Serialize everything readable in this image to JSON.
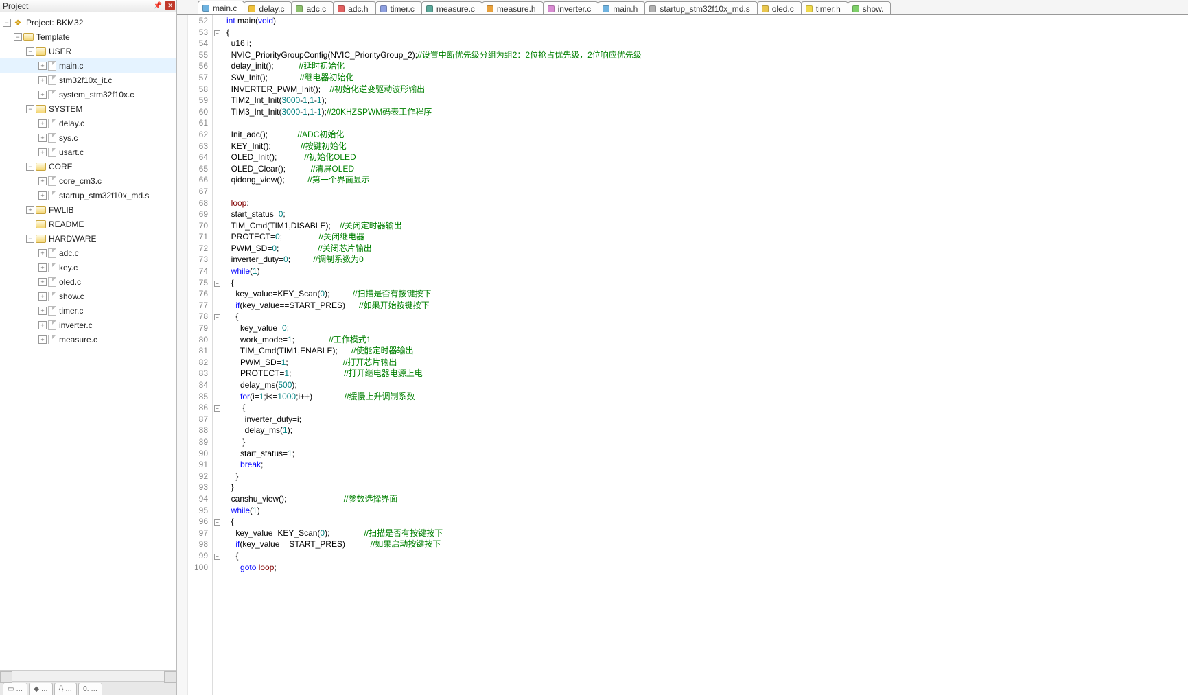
{
  "panel": {
    "title": "Project"
  },
  "tree": {
    "root": "Project: BKM32",
    "template": "Template",
    "groups": {
      "user": {
        "name": "USER",
        "files": [
          "main.c",
          "stm32f10x_it.c",
          "system_stm32f10x.c"
        ]
      },
      "system": {
        "name": "SYSTEM",
        "files": [
          "delay.c",
          "sys.c",
          "usart.c"
        ]
      },
      "core": {
        "name": "CORE",
        "files": [
          "core_cm3.c",
          "startup_stm32f10x_md.s"
        ]
      },
      "fwlib": {
        "name": "FWLIB"
      },
      "readme": {
        "name": "README"
      },
      "hardware": {
        "name": "HARDWARE",
        "files": [
          "adc.c",
          "key.c",
          "oled.c",
          "show.c",
          "timer.c",
          "inverter.c",
          "measure.c"
        ]
      }
    }
  },
  "tabs": [
    {
      "label": "main.c",
      "color": "#6fb3e0",
      "active": true
    },
    {
      "label": "delay.c",
      "color": "#f0c23c",
      "active": false
    },
    {
      "label": "adc.c",
      "color": "#8cc06d",
      "active": false
    },
    {
      "label": "adc.h",
      "color": "#e26060",
      "active": false
    },
    {
      "label": "timer.c",
      "color": "#8d9fe0",
      "active": false
    },
    {
      "label": "measure.c",
      "color": "#5aa89a",
      "active": false
    },
    {
      "label": "measure.h",
      "color": "#e9a13b",
      "active": false
    },
    {
      "label": "inverter.c",
      "color": "#d98bd3",
      "active": false
    },
    {
      "label": "main.h",
      "color": "#6fb3e0",
      "active": false
    },
    {
      "label": "startup_stm32f10x_md.s",
      "color": "#b0b0b0",
      "active": false
    },
    {
      "label": "oled.c",
      "color": "#e9c64e",
      "active": false
    },
    {
      "label": "timer.h",
      "color": "#f0d94a",
      "active": false
    },
    {
      "label": "show.",
      "color": "#7fd06a",
      "active": false
    }
  ],
  "code": {
    "first_line_number": 52,
    "fold_lines": [
      53,
      75,
      78,
      86,
      96,
      99
    ],
    "lines": [
      [
        [
          "kw",
          "int "
        ],
        [
          "fn",
          "main"
        ],
        [
          "id",
          "("
        ],
        [
          "kw",
          "void"
        ],
        [
          "id",
          ")"
        ]
      ],
      [
        [
          "id",
          "{"
        ]
      ],
      [
        [
          "id",
          "  u16 i;"
        ]
      ],
      [
        [
          "id",
          "  NVIC_PriorityGroupConfig(NVIC_PriorityGroup_2);"
        ],
        [
          "cm",
          "//设置中断优先级分组为组2：2位抢占优先级，2位响应优先级"
        ]
      ],
      [
        [
          "id",
          "  delay_init();           "
        ],
        [
          "cm",
          "//延时初始化"
        ]
      ],
      [
        [
          "id",
          "  SW_Init();              "
        ],
        [
          "cm",
          "//继电器初始化"
        ]
      ],
      [
        [
          "id",
          "  INVERTER_PWM_Init();    "
        ],
        [
          "cm",
          "//初始化逆变驱动波形输出"
        ]
      ],
      [
        [
          "id",
          "  TIM2_Int_Init("
        ],
        [
          "num",
          "3000"
        ],
        [
          "id",
          "-"
        ],
        [
          "num",
          "1"
        ],
        [
          "id",
          ","
        ],
        [
          "num",
          "1"
        ],
        [
          "id",
          "-"
        ],
        [
          "num",
          "1"
        ],
        [
          "id",
          ");"
        ]
      ],
      [
        [
          "id",
          "  TIM3_Int_Init("
        ],
        [
          "num",
          "3000"
        ],
        [
          "id",
          "-"
        ],
        [
          "num",
          "1"
        ],
        [
          "id",
          ","
        ],
        [
          "num",
          "1"
        ],
        [
          "id",
          "-"
        ],
        [
          "num",
          "1"
        ],
        [
          "id",
          ");"
        ],
        [
          "cm",
          "//20KHZSPWM码表工作程序"
        ]
      ],
      [
        [
          "id",
          ""
        ]
      ],
      [
        [
          "id",
          "  Init_adc();             "
        ],
        [
          "cm",
          "//ADC初始化"
        ]
      ],
      [
        [
          "id",
          "  KEY_Init();             "
        ],
        [
          "cm",
          "//按键初始化"
        ]
      ],
      [
        [
          "id",
          "  OLED_Init();            "
        ],
        [
          "cm",
          "//初始化OLED"
        ]
      ],
      [
        [
          "id",
          "  OLED_Clear();           "
        ],
        [
          "cm",
          "//清屏OLED"
        ]
      ],
      [
        [
          "id",
          "  qidong_view();          "
        ],
        [
          "cm",
          "//第一个界面显示"
        ]
      ],
      [
        [
          "id",
          ""
        ]
      ],
      [
        [
          "id",
          "  "
        ],
        [
          "lbl2",
          "loop"
        ],
        [
          "id",
          ":"
        ]
      ],
      [
        [
          "id",
          "  start_status="
        ],
        [
          "num",
          "0"
        ],
        [
          "id",
          ";"
        ]
      ],
      [
        [
          "id",
          "  TIM_Cmd(TIM1,DISABLE);    "
        ],
        [
          "cm",
          "//关闭定时器输出"
        ]
      ],
      [
        [
          "id",
          "  PROTECT="
        ],
        [
          "num",
          "0"
        ],
        [
          "id",
          ";                "
        ],
        [
          "cm",
          "//关闭继电器"
        ]
      ],
      [
        [
          "id",
          "  PWM_SD="
        ],
        [
          "num",
          "0"
        ],
        [
          "id",
          ";                 "
        ],
        [
          "cm",
          "//关闭芯片输出"
        ]
      ],
      [
        [
          "id",
          "  inverter_duty="
        ],
        [
          "num",
          "0"
        ],
        [
          "id",
          ";          "
        ],
        [
          "cm",
          "//调制系数为0"
        ]
      ],
      [
        [
          "id",
          "  "
        ],
        [
          "kw",
          "while"
        ],
        [
          "id",
          "("
        ],
        [
          "num",
          "1"
        ],
        [
          "id",
          ")"
        ]
      ],
      [
        [
          "id",
          "  {"
        ]
      ],
      [
        [
          "id",
          "    key_value=KEY_Scan("
        ],
        [
          "num",
          "0"
        ],
        [
          "id",
          ");          "
        ],
        [
          "cm",
          "//扫描是否有按键按下"
        ]
      ],
      [
        [
          "id",
          "    "
        ],
        [
          "kw",
          "if"
        ],
        [
          "id",
          "(key_value==START_PRES)      "
        ],
        [
          "cm",
          "//如果开始按键按下"
        ]
      ],
      [
        [
          "id",
          "    {"
        ]
      ],
      [
        [
          "id",
          "      key_value="
        ],
        [
          "num",
          "0"
        ],
        [
          "id",
          ";"
        ]
      ],
      [
        [
          "id",
          "      work_mode="
        ],
        [
          "num",
          "1"
        ],
        [
          "id",
          ";               "
        ],
        [
          "cm",
          "//工作模式1"
        ]
      ],
      [
        [
          "id",
          "      TIM_Cmd(TIM1,ENABLE);      "
        ],
        [
          "cm",
          "//使能定时器输出"
        ]
      ],
      [
        [
          "id",
          "      PWM_SD="
        ],
        [
          "num",
          "1"
        ],
        [
          "id",
          ";                        "
        ],
        [
          "cm",
          "//打开芯片输出"
        ]
      ],
      [
        [
          "id",
          "      PROTECT="
        ],
        [
          "num",
          "1"
        ],
        [
          "id",
          ";                       "
        ],
        [
          "cm",
          "//打开继电器电源上电"
        ]
      ],
      [
        [
          "id",
          "      delay_ms("
        ],
        [
          "num",
          "500"
        ],
        [
          "id",
          ");"
        ]
      ],
      [
        [
          "id",
          "      "
        ],
        [
          "kw",
          "for"
        ],
        [
          "id",
          "(i="
        ],
        [
          "num",
          "1"
        ],
        [
          "id",
          ";i<="
        ],
        [
          "num",
          "1000"
        ],
        [
          "id",
          ";i++)              "
        ],
        [
          "cm",
          "//缓慢上升调制系数"
        ]
      ],
      [
        [
          "id",
          "       {"
        ]
      ],
      [
        [
          "id",
          "        inverter_duty=i;"
        ]
      ],
      [
        [
          "id",
          "        delay_ms("
        ],
        [
          "num",
          "1"
        ],
        [
          "id",
          ");"
        ]
      ],
      [
        [
          "id",
          "       }"
        ]
      ],
      [
        [
          "id",
          "      start_status="
        ],
        [
          "num",
          "1"
        ],
        [
          "id",
          ";"
        ]
      ],
      [
        [
          "id",
          "      "
        ],
        [
          "kw",
          "break"
        ],
        [
          "id",
          ";"
        ]
      ],
      [
        [
          "id",
          "    }"
        ]
      ],
      [
        [
          "id",
          "  }"
        ]
      ],
      [
        [
          "id",
          "  canshu_view();                         "
        ],
        [
          "cm",
          "//参数选择界面"
        ]
      ],
      [
        [
          "id",
          "  "
        ],
        [
          "kw",
          "while"
        ],
        [
          "id",
          "("
        ],
        [
          "num",
          "1"
        ],
        [
          "id",
          ")"
        ]
      ],
      [
        [
          "id",
          "  {"
        ]
      ],
      [
        [
          "id",
          "    key_value=KEY_Scan("
        ],
        [
          "num",
          "0"
        ],
        [
          "id",
          ");               "
        ],
        [
          "cm",
          "//扫描是否有按键按下"
        ]
      ],
      [
        [
          "id",
          "    "
        ],
        [
          "kw",
          "if"
        ],
        [
          "id",
          "(key_value==START_PRES)           "
        ],
        [
          "cm",
          "//如果启动按键按下"
        ]
      ],
      [
        [
          "id",
          "    {"
        ]
      ],
      [
        [
          "id",
          "      "
        ],
        [
          "kw",
          "goto"
        ],
        [
          "id",
          " "
        ],
        [
          "lbl2",
          "loop"
        ],
        [
          "id",
          ";"
        ]
      ]
    ]
  }
}
